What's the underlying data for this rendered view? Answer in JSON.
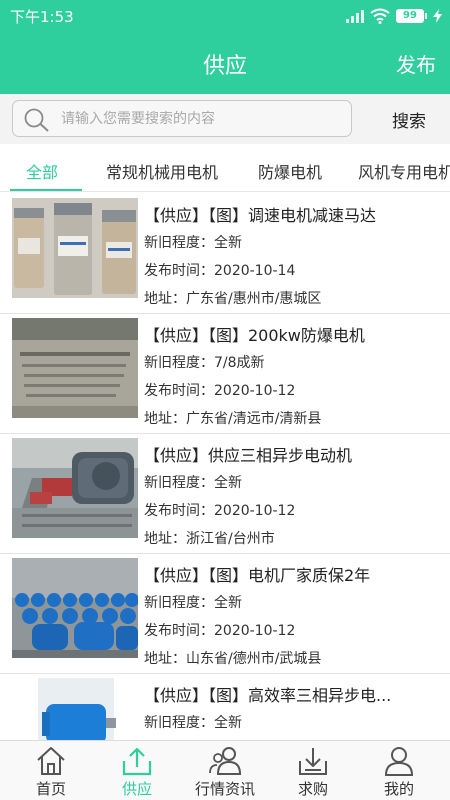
{
  "status_bar": {
    "time": "下午1:53",
    "battery": "99"
  },
  "header": {
    "title": "供应",
    "publish_label": "发布"
  },
  "search": {
    "placeholder": "请输入您需要搜索的内容",
    "button_label": "搜索"
  },
  "tabs": [
    {
      "label": "全部",
      "active": true
    },
    {
      "label": "常规机械用电机",
      "active": false
    },
    {
      "label": "防爆电机",
      "active": false
    },
    {
      "label": "风机专用电机",
      "active": false
    }
  ],
  "listings": [
    {
      "title": "【供应】【图】调速电机减速马达",
      "condition": "新旧程度：全新",
      "date": "发布时间：2020-10-14",
      "address": "地址：广东省/惠州市/惠城区"
    },
    {
      "title": "【供应】【图】200kw防爆电机",
      "condition": "新旧程度：7/8成新",
      "date": "发布时间：2020-10-12",
      "address": "地址：广东省/清远市/清新县"
    },
    {
      "title": "【供应】供应三相异步电动机",
      "condition": "新旧程度：全新",
      "date": "发布时间：2020-10-12",
      "address": "地址：浙江省/台州市"
    },
    {
      "title": "【供应】【图】电机厂家质保2年",
      "condition": "新旧程度：全新",
      "date": "发布时间：2020-10-12",
      "address": "地址：山东省/德州市/武城县"
    },
    {
      "title": "【供应】【图】高效率三相异步电...",
      "condition": "新旧程度：全新",
      "date": "",
      "address": ""
    }
  ],
  "bottom_nav": [
    {
      "label": "首页",
      "icon": "home-icon",
      "active": false
    },
    {
      "label": "供应",
      "icon": "upload-icon",
      "active": true
    },
    {
      "label": "行情资讯",
      "icon": "people-icon",
      "active": false
    },
    {
      "label": "求购",
      "icon": "download-icon",
      "active": false
    },
    {
      "label": "我的",
      "icon": "user-icon",
      "active": false
    }
  ],
  "colors": {
    "brand": "#2ecf9d",
    "nav_inactive": "#555555"
  }
}
